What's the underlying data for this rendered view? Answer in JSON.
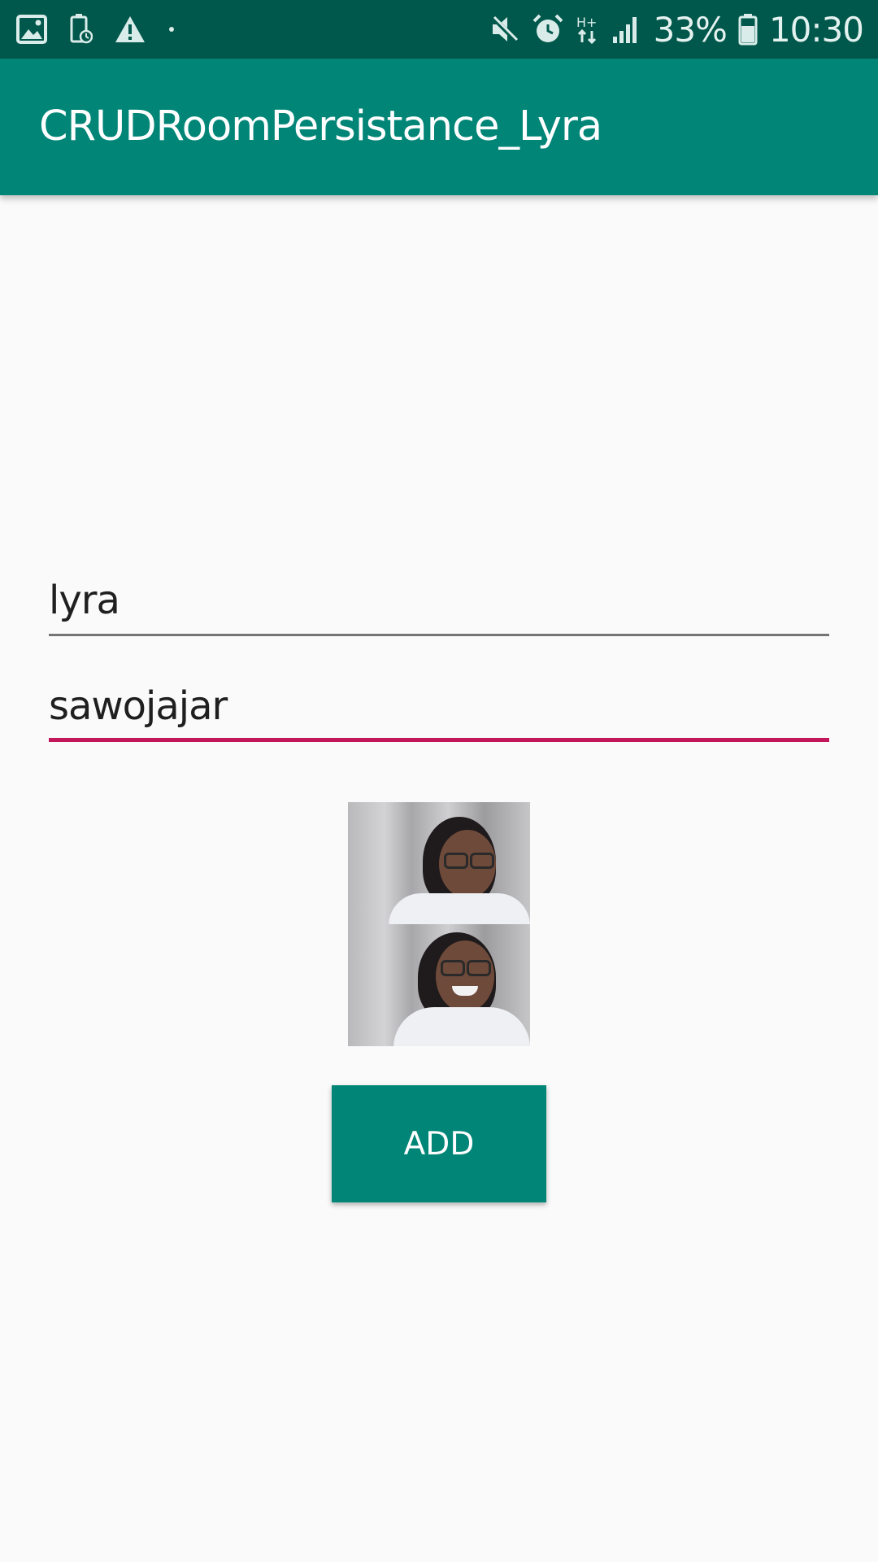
{
  "status_bar": {
    "battery_percent": "33%",
    "time": "10:30",
    "network_type": "H+",
    "icons": [
      "image-icon",
      "battery-saver-icon",
      "warning-icon",
      "dot-icon",
      "mute-icon",
      "alarm-icon",
      "network-arrows-icon",
      "signal-icon",
      "battery-icon"
    ]
  },
  "app_bar": {
    "title": "CRUDRoomPersistance_Lyra",
    "color": "#008577"
  },
  "form": {
    "name_value": "lyra",
    "address_value": "sawojajar",
    "focus_color": "#c2185b"
  },
  "add_button": {
    "label": "ADD",
    "color": "#008577"
  }
}
